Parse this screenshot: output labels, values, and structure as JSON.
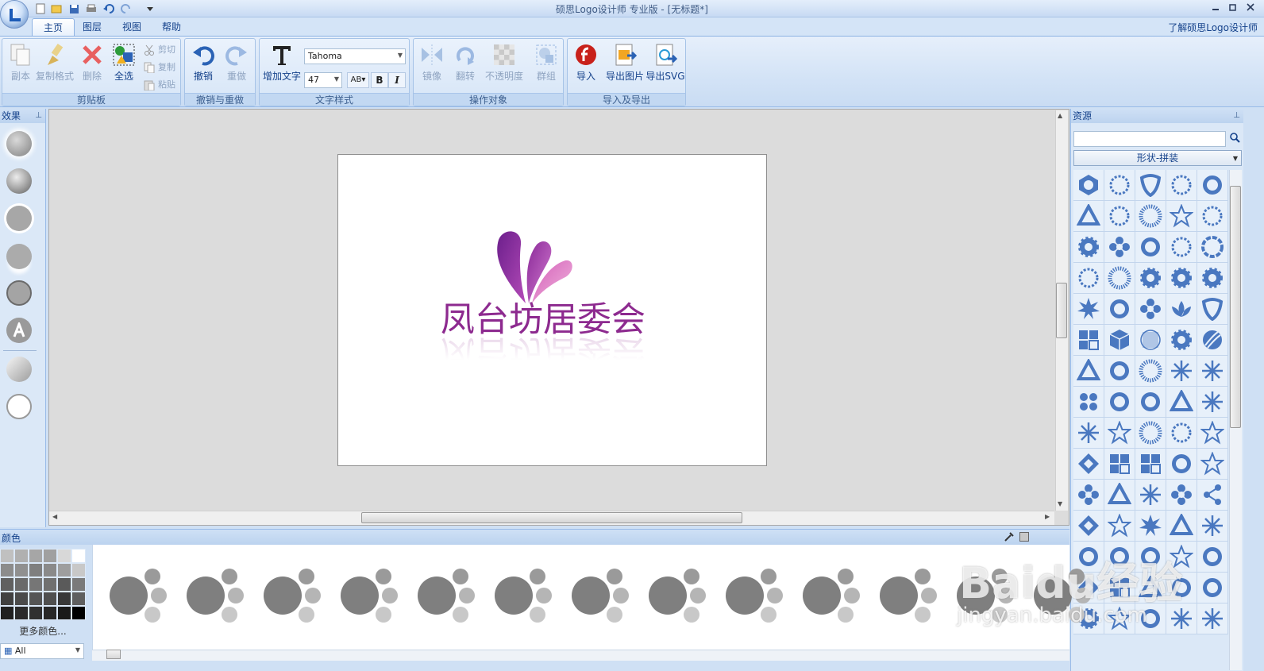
{
  "window": {
    "title": "硕思Logo设计师 专业版 - [无标题*]"
  },
  "tabs": [
    {
      "label": "主页"
    },
    {
      "label": "图层"
    },
    {
      "label": "视图"
    },
    {
      "label": "帮助"
    }
  ],
  "about_link": "了解硕思Logo设计师",
  "ribbon": {
    "clipboard": {
      "label": "剪贴板",
      "duplicate": "副本",
      "format_painter": "复制格式",
      "delete": "删除",
      "select_all": "全选",
      "cut": "剪切",
      "copy": "复制",
      "paste": "粘贴"
    },
    "undo_redo": {
      "label": "撤销与重做",
      "undo": "撤销",
      "redo": "重做"
    },
    "text_style": {
      "label": "文字样式",
      "add_text": "增加文字",
      "font": "Tahoma",
      "size": "47",
      "bold": "B",
      "italic": "I"
    },
    "operate": {
      "label": "操作对象",
      "mirror": "镜像",
      "rotate": "翻转",
      "opacity": "不透明度",
      "group": "群组"
    },
    "import_export": {
      "label": "导入及导出",
      "import": "导入",
      "export_image": "导出图片",
      "export_svg": "导出SVG"
    }
  },
  "left_panel": {
    "title": "效果"
  },
  "canvas": {
    "logo_text": "凤台坊居委会"
  },
  "right_panel": {
    "title": "资源",
    "category": "形状-拼装"
  },
  "bottom": {
    "title": "颜色",
    "more_colors": "更多颜色...",
    "filter": "All"
  },
  "watermark": {
    "brand": "Baidu经验",
    "url": "jingyan.baidu.com"
  },
  "colors": {
    "accent": "#15428b",
    "shape_fill": "#4a78c0",
    "logo_purple": "#8d2a8f",
    "swatch_gray": "#7f7f7f"
  }
}
